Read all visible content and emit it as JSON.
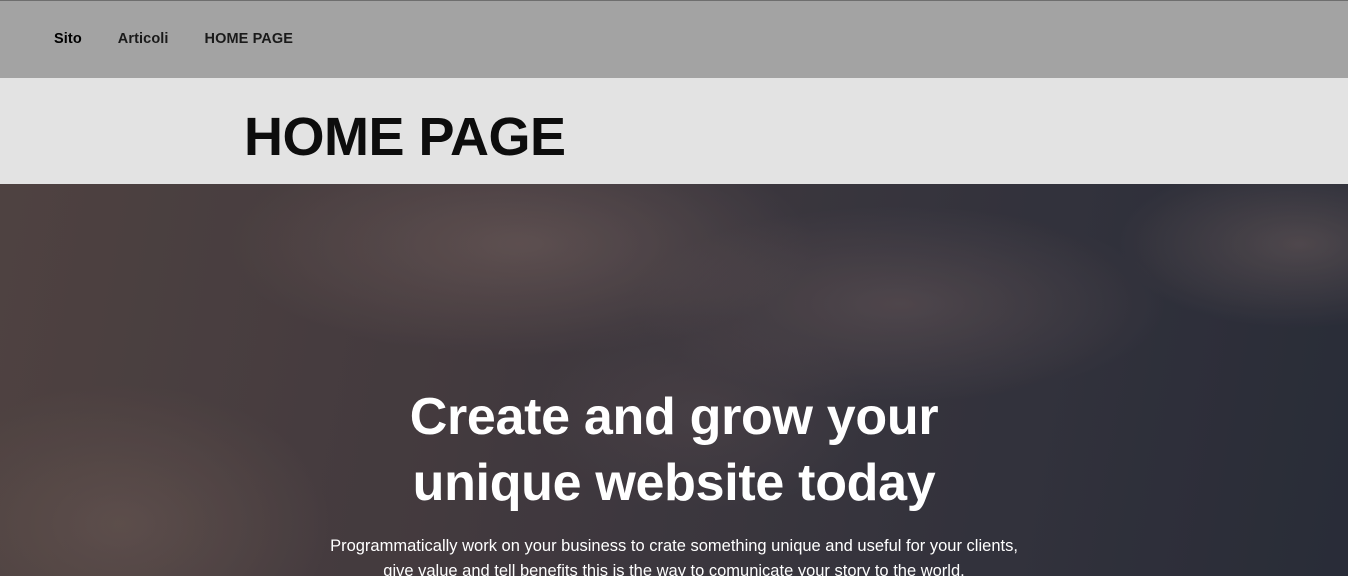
{
  "nav": {
    "brand": "Sito",
    "items": [
      {
        "label": "Articoli"
      },
      {
        "label": "HOME PAGE"
      }
    ]
  },
  "page": {
    "title": "HOME PAGE"
  },
  "hero": {
    "heading_line1": "Create and grow your",
    "heading_line2": "unique website today",
    "text_line1": "Programmatically work on your business to crate something unique and useful for your clients,",
    "text_line2": "give value and tell benefits this is the way to comunicate your story to the world."
  },
  "colors": {
    "nav_background": "#a3a3a3",
    "title_band_background": "#e3e3e3",
    "hero_text": "#ffffff"
  }
}
